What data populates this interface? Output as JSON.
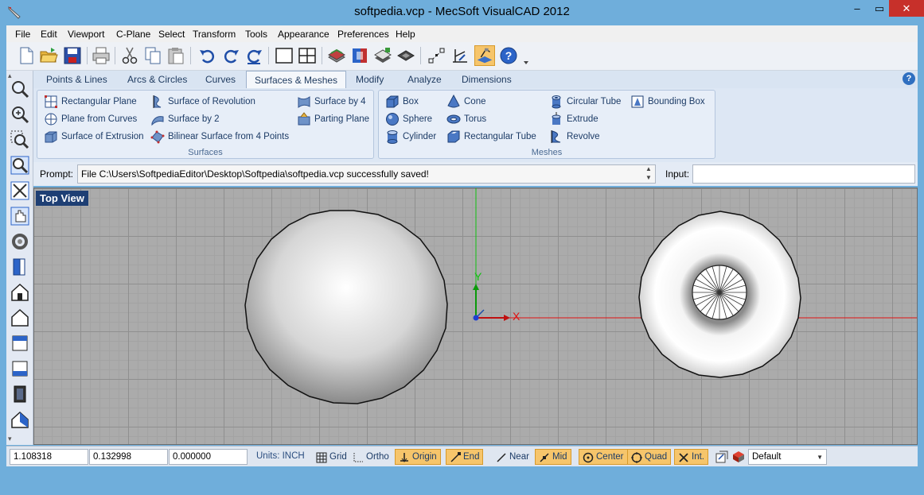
{
  "window": {
    "title": "softpedia.vcp - MecSoft VisualCAD 2012",
    "minimize": "‒",
    "maximize": "▭",
    "close": "✕"
  },
  "menu": [
    "File",
    "Edit",
    "Viewport",
    "C-Plane",
    "Select",
    "Transform",
    "Tools",
    "Appearance",
    "Preferences",
    "Help"
  ],
  "ribbon": {
    "tabs": [
      "Points & Lines",
      "Arcs & Circles",
      "Curves",
      "Surfaces & Meshes",
      "Modify",
      "Analyze",
      "Dimensions"
    ],
    "active_tab": "Surfaces & Meshes",
    "help": "?",
    "surfaces": {
      "title": "Surfaces",
      "items": [
        "Rectangular Plane",
        "Plane from Curves",
        "Surface of Extrusion",
        "Surface of Revolution",
        "Surface by 2",
        "Bilinear Surface from 4 Points",
        "Surface by 4",
        "Parting Plane"
      ]
    },
    "meshes": {
      "title": "Meshes",
      "items": [
        "Box",
        "Sphere",
        "Cylinder",
        "Cone",
        "Torus",
        "Rectangular Tube",
        "Circular Tube",
        "Extrude",
        "Revolve",
        "Bounding Box"
      ]
    }
  },
  "prompt": {
    "label": "Prompt:",
    "text": "File C:\\Users\\SoftpediaEditor\\Desktop\\Softpedia\\softpedia.vcp successfully saved!",
    "input_label": "Input:",
    "input_value": ""
  },
  "viewport": {
    "label": "Top View",
    "axis_x": "X",
    "axis_y": "Y"
  },
  "status": {
    "x": "1.108318",
    "y": "0.132998",
    "z": "0.000000",
    "units": "Units: INCH",
    "grid": "Grid",
    "ortho": "Ortho",
    "origin": "Origin",
    "end": "End",
    "near": "Near",
    "mid": "Mid",
    "center": "Center",
    "quad": "Quad",
    "int": "Int.",
    "layer": "Default"
  },
  "colors": {
    "title_bg": "#6faedb",
    "close_btn": "#c7302a",
    "snap_active": "#f6c56b",
    "axis_x": "#e01010",
    "axis_y": "#10c010",
    "view_label_bg": "#1e3f74"
  }
}
